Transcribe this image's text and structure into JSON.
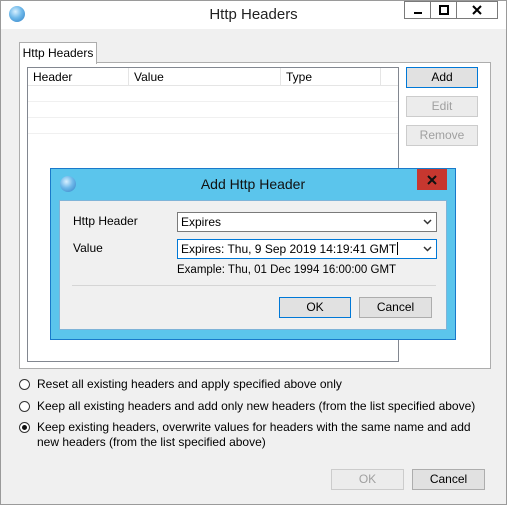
{
  "window": {
    "title": "Http Headers"
  },
  "tab": {
    "label": "Http Headers"
  },
  "list": {
    "columns": [
      "Header",
      "Value",
      "Type"
    ]
  },
  "side_buttons": {
    "add": "Add",
    "edit": "Edit",
    "remove": "Remove"
  },
  "options": [
    {
      "label": "Reset all existing headers and apply specified above only",
      "checked": false
    },
    {
      "label": "Keep all existing headers and add only new headers (from the list specified above)",
      "checked": false
    },
    {
      "label": "Keep existing headers, overwrite values for headers with the same name and add new headers (from the list specified above)",
      "checked": true
    }
  ],
  "footer": {
    "ok": "OK",
    "cancel": "Cancel"
  },
  "dialog": {
    "title": "Add Http Header",
    "header_label": "Http Header",
    "header_value": "Expires",
    "value_label": "Value",
    "value_value": "Expires: Thu, 9 Sep 2019 14:19:41 GMT",
    "example": "Example: Thu, 01 Dec 1994 16:00:00 GMT",
    "ok": "OK",
    "cancel": "Cancel"
  },
  "icons": {
    "app": "globe-cloud-icon",
    "minimize": "minimize-icon",
    "maximize": "maximize-icon",
    "close": "close-icon",
    "dropdown": "chevron-down-icon"
  },
  "colors": {
    "dialog_frame": "#5bc5ec",
    "close_red": "#c7372f",
    "accent": "#0078d7"
  }
}
